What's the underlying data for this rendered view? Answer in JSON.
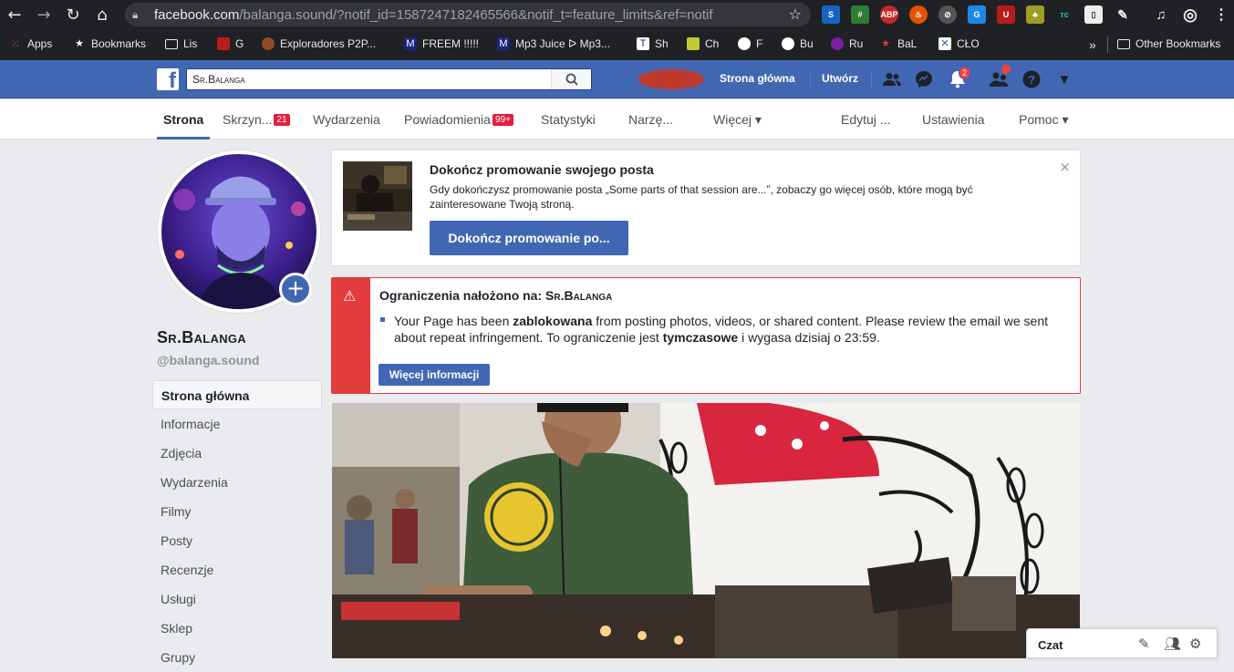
{
  "browser": {
    "url_host": "facebook.com",
    "url_path": "/balanga.sound/?notif_id=1587247182465566&notif_t=feature_limits&ref=notif",
    "bookmarks": [
      {
        "label": "Apps",
        "icon": "apps-grid-icon"
      },
      {
        "label": "Bookmarks",
        "icon": "star-icon"
      },
      {
        "label": "Lis",
        "icon": "folder-icon"
      },
      {
        "label": "G",
        "icon": "site-icon"
      },
      {
        "label": "Exploradores P2P...",
        "icon": "site-icon"
      },
      {
        "label": "FREEM !!!!!",
        "icon": "site-icon"
      },
      {
        "label": "Mp3 Juice ᐅ Mp3...",
        "icon": "site-icon"
      },
      {
        "label": "Sh",
        "icon": "site-icon"
      },
      {
        "label": "Ch",
        "icon": "site-icon"
      },
      {
        "label": "F",
        "icon": "site-icon"
      },
      {
        "label": "Bu",
        "icon": "site-icon"
      },
      {
        "label": "Ru",
        "icon": "site-icon"
      },
      {
        "label": "BaL",
        "icon": "site-icon"
      },
      {
        "label": "CŁO",
        "icon": "site-icon"
      }
    ],
    "bookmarks_more": "»",
    "other_bookmarks": "Other Bookmarks"
  },
  "fb_header": {
    "search_value": "Sr.Balanga",
    "home_link": "Strona główna",
    "create_link": "Utwórz",
    "notifications_count": "2"
  },
  "page_nav": {
    "items": [
      {
        "label": "Strona",
        "count": ""
      },
      {
        "label": "Skrzyn...",
        "count": "21"
      },
      {
        "label": "Wydarzenia",
        "count": ""
      },
      {
        "label": "Powiadomienia",
        "count": "99+"
      },
      {
        "label": "Statystyki",
        "count": ""
      },
      {
        "label": "Narzę...",
        "count": ""
      },
      {
        "label": "Więcej ▾",
        "count": ""
      },
      {
        "label": "Edytuj ...",
        "count": ""
      },
      {
        "label": "Ustawienia",
        "count": ""
      },
      {
        "label": "Pomoc ▾",
        "count": ""
      }
    ]
  },
  "sidebar": {
    "page_name": "Sr.Balanga",
    "handle": "@balanga.sound",
    "items": [
      "Strona główna",
      "Informacje",
      "Zdjęcia",
      "Wydarzenia",
      "Filmy",
      "Posty",
      "Recenzje",
      "Usługi",
      "Sklep",
      "Grupy"
    ]
  },
  "promo": {
    "title": "Dokończ promowanie swojego posta",
    "text": "Gdy dokończysz promowanie posta „Some parts of that session are...”, zobaczy go więcej osób, które mogą być zainteresowane Twoją stroną.",
    "button": "Dokończ promowanie po...",
    "close": "×"
  },
  "restriction": {
    "title_prefix": "Ograniczenia nałożono na: ",
    "title_name": "Sr.Balanga",
    "text_1": "Your Page has been ",
    "text_bold_1": "zablokowana",
    "text_2": " from posting photos, videos, or shared content. Please review the email we sent about repeat infringement. To ograniczenie jest ",
    "text_bold_2": "tymczasowe",
    "text_3": " i wygasa dzisiaj o 23:59.",
    "button": "Więcej informacji"
  },
  "chat": {
    "label": "Czat"
  },
  "colors": {
    "fb_blue": "#4267b2",
    "alert_red": "#e33c3c",
    "chrome_dark": "#202124"
  }
}
